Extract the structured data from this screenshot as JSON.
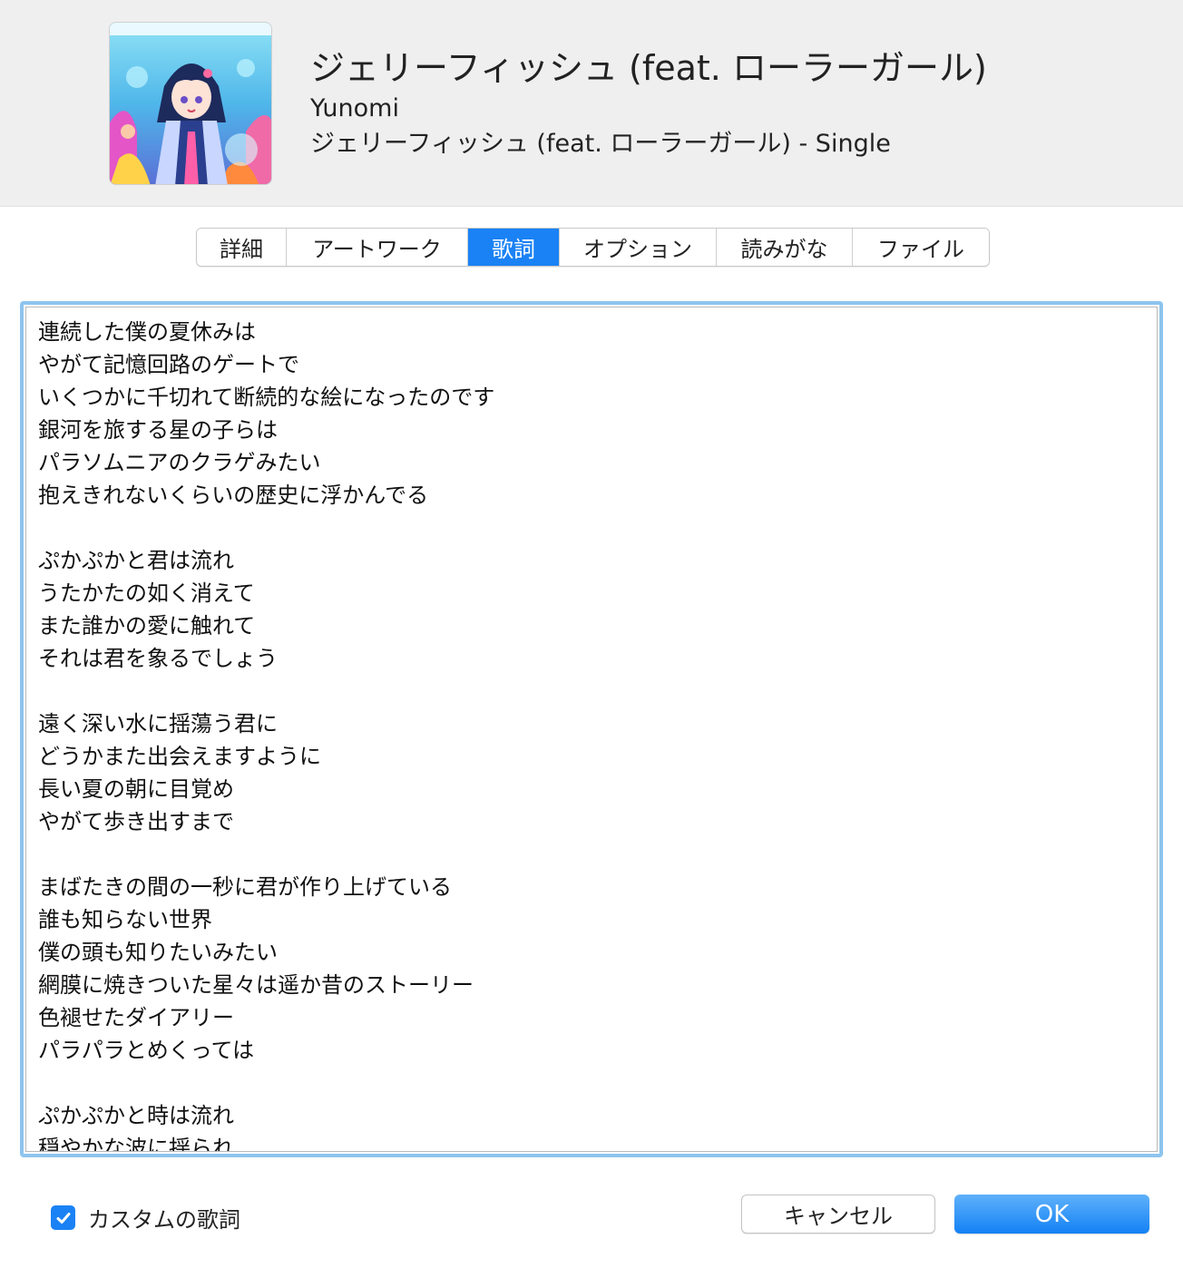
{
  "song": {
    "title": "ジェリーフィッシュ (feat. ローラーガール)",
    "artist": "Yunomi",
    "album": "ジェリーフィッシュ (feat. ローラーガール) - Single"
  },
  "tabs": [
    {
      "label": "詳細",
      "active": false
    },
    {
      "label": "アートワーク",
      "active": false
    },
    {
      "label": "歌詞",
      "active": true
    },
    {
      "label": "オプション",
      "active": false
    },
    {
      "label": "読みがな",
      "active": false
    },
    {
      "label": "ファイル",
      "active": false
    }
  ],
  "lyrics": [
    "連続した僕の夏休みは",
    "やがて記憶回路のゲートで",
    "いくつかに千切れて断続的な絵になったのです",
    "銀河を旅する星の子らは",
    "パラソムニアのクラゲみたい",
    "抱えきれないくらいの歴史に浮かんでる",
    "",
    "ぷかぷかと君は流れ",
    "うたかたの如く消えて",
    "また誰かの愛に触れて",
    "それは君を象るでしょう",
    "",
    "遠く深い水に揺蕩う君に",
    "どうかまた出会えますように",
    "長い夏の朝に目覚め",
    "やがて歩き出すまで",
    "",
    "まばたきの間の一秒に君が作り上げている",
    "誰も知らない世界",
    "僕の頭も知りたいみたい",
    "網膜に焼きついた星々は遥か昔のストーリー",
    "色褪せたダイアリー",
    "パラパラとめくっては",
    "",
    "ぷかぷかと時は流れ",
    "穏やかな波に揺られ"
  ],
  "footer": {
    "custom_lyrics_label": "カスタムの歌詞",
    "custom_lyrics_checked": true,
    "cancel_label": "キャンセル",
    "ok_label": "OK"
  },
  "colors": {
    "accent": "#1a82f5",
    "focus_ring": "#8ec4ee",
    "header_bg": "#efefef"
  }
}
